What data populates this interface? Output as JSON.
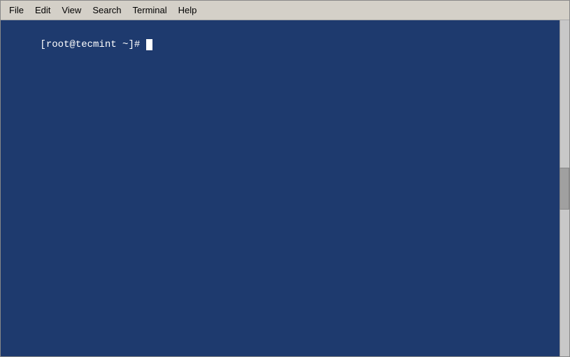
{
  "menubar": {
    "items": [
      {
        "id": "file",
        "label": "File"
      },
      {
        "id": "edit",
        "label": "Edit"
      },
      {
        "id": "view",
        "label": "View"
      },
      {
        "id": "search",
        "label": "Search"
      },
      {
        "id": "terminal",
        "label": "Terminal"
      },
      {
        "id": "help",
        "label": "Help"
      }
    ]
  },
  "terminal": {
    "prompt": "[root@tecmint ~]# ",
    "background_color": "#1e3a6e"
  }
}
